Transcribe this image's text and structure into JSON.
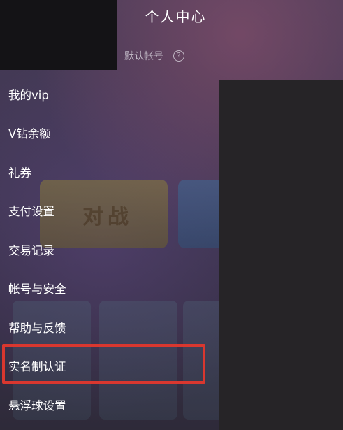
{
  "header": {
    "title": "个人中心"
  },
  "account": {
    "label": "默认帐号",
    "help_icon": "question-circle-icon",
    "help_glyph": "?"
  },
  "menu": {
    "items": [
      {
        "label": "我的vip"
      },
      {
        "label": "V钻余额"
      },
      {
        "label": "礼券"
      },
      {
        "label": "支付设置"
      },
      {
        "label": "交易记录"
      },
      {
        "label": "帐号与安全"
      },
      {
        "label": "帮助与反馈"
      },
      {
        "label": "实名制认证"
      },
      {
        "label": "悬浮球设置"
      }
    ],
    "highlighted_item": "实名制认证"
  },
  "background": {
    "game_text": "对战"
  },
  "colors": {
    "highlight_border": "#d9372f",
    "text": "#ffffff",
    "redaction": "#262427"
  }
}
